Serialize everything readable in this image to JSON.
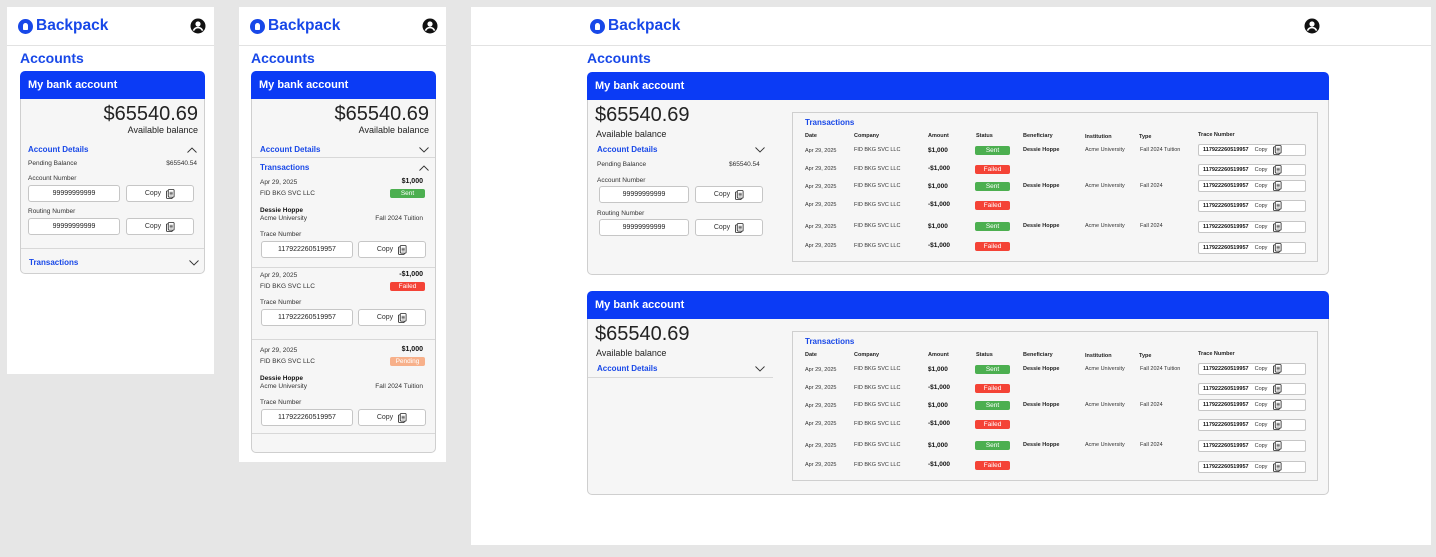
{
  "brand": {
    "name": "Backpack",
    "accent": "#1848e8",
    "header_blue": "#0b3bf5"
  },
  "page_title": "Accounts",
  "account": {
    "title": "My bank account",
    "balance": "$65540.69",
    "balance_label": "Available balance",
    "account_details_label": "Account Details",
    "transactions_label": "Transactions",
    "pending_label": "Pending Balance",
    "pending_value": "$65540.54",
    "account_number_label": "Account Number",
    "account_number": "99999999999",
    "routing_number_label": "Routing Number",
    "routing_number": "99999999999",
    "copy_label": "Copy"
  },
  "mobile_transactions": [
    {
      "date": "Apr 29, 2025",
      "company": "FID BKG SVC LLC",
      "amount": "$1,000",
      "status": "Sent",
      "beneficiary": "Dessie Hoppe",
      "institution": "Acme University",
      "type": "Fall 2024 Tuition",
      "trace_label": "Trace Number",
      "trace": "117922260519957"
    },
    {
      "date": "Apr 29, 2025",
      "company": "FID BKG SVC LLC",
      "amount": "-$1,000",
      "status": "Failed",
      "beneficiary": "",
      "institution": "",
      "type": "",
      "trace_label": "Trace Number",
      "trace": "117922260519957"
    },
    {
      "date": "Apr 29, 2025",
      "company": "FID BKG SVC LLC",
      "amount": "$1,000",
      "status": "Pending",
      "beneficiary": "Dessie Hoppe",
      "institution": "Acme University",
      "type": "Fall 2024 Tuition",
      "trace_label": "Trace Number",
      "trace": "117922260519957"
    }
  ],
  "table": {
    "title": "Transactions",
    "columns": [
      "Date",
      "Company",
      "Amount",
      "Status",
      "Beneficiary",
      "Institution",
      "Type",
      "Trace Number"
    ],
    "rows": [
      {
        "date": "Apr 29, 2025",
        "company": "FID BKG SVC LLC",
        "amount": "$1,000",
        "status": "Sent",
        "beneficiary": "Dessie Hoppe",
        "institution": "Acme University",
        "type": "Fall 2024 Tuition",
        "trace": "117922260519957"
      },
      {
        "date": "Apr 29, 2025",
        "company": "FID BKG SVC LLC",
        "amount": "-$1,000",
        "status": "Failed",
        "beneficiary": "",
        "institution": "",
        "type": "",
        "trace": "117922260519957"
      },
      {
        "date": "Apr 29, 2025",
        "company": "FID BKG SVC LLC",
        "amount": "$1,000",
        "status": "Sent",
        "beneficiary": "Dessie Hoppe",
        "institution": "Acme University",
        "type": "Fall 2024",
        "trace": "117922260519957"
      },
      {
        "date": "Apr 29, 2025",
        "company": "FID BKG SVC LLC",
        "amount": "-$1,000",
        "status": "Failed",
        "beneficiary": "",
        "institution": "",
        "type": "",
        "trace": "117922260519957"
      },
      {
        "date": "Apr 29, 2025",
        "company": "FID BKG SVC LLC",
        "amount": "$1,000",
        "status": "Sent",
        "beneficiary": "Dessie Hoppe",
        "institution": "Acme University",
        "type": "Fall 2024",
        "trace": "117922260519957"
      },
      {
        "date": "Apr 29, 2025",
        "company": "FID BKG SVC LLC",
        "amount": "-$1,000",
        "status": "Failed",
        "beneficiary": "",
        "institution": "",
        "type": "",
        "trace": "117922260519957"
      }
    ]
  },
  "status_colors": {
    "Sent": "#4caf50",
    "Failed": "#f44336",
    "Pending": "#f7b08a"
  }
}
